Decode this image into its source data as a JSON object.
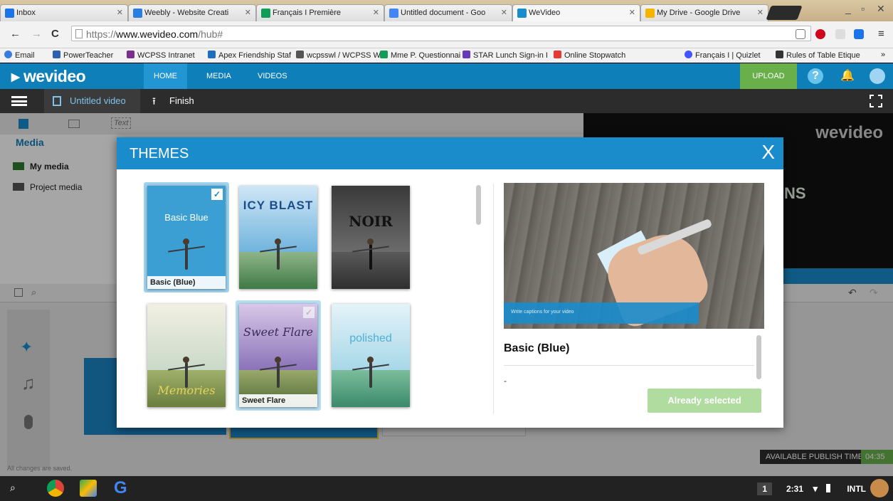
{
  "browser": {
    "tabs": [
      {
        "label": "Inbox",
        "icon": "inbox-icon",
        "color": "#1a73e8"
      },
      {
        "label": "Weebly - Website Creati",
        "icon": "weebly-icon",
        "color": "#2a7de1"
      },
      {
        "label": "Français I Première",
        "icon": "classroom-icon",
        "color": "#0f9d58"
      },
      {
        "label": "Untitled document - Goo",
        "icon": "docs-icon",
        "color": "#4285f4"
      },
      {
        "label": "WeVideo",
        "icon": "wevideo-icon",
        "color": "#1a8ccc"
      },
      {
        "label": "My Drive - Google Drive",
        "icon": "drive-icon",
        "color": "#f4b400"
      }
    ],
    "url_prefix": "https://",
    "url_host": "www.wevideo.com",
    "url_path": "/hub#",
    "bookmarks": [
      {
        "label": "Email",
        "color": "#3b7ddd"
      },
      {
        "label": "PowerTeacher",
        "color": "#2f5fae"
      },
      {
        "label": "WCPSS Intranet",
        "color": "#7a2e8e"
      },
      {
        "label": "Apex Friendship Staf",
        "color": "#1f6fbf"
      },
      {
        "label": "wcpsswl / WCPSS W",
        "color": "#555555"
      },
      {
        "label": "Mme P. Questionnai",
        "color": "#0f9d58"
      },
      {
        "label": "STAR Lunch Sign-in I",
        "color": "#673ab7"
      },
      {
        "label": "Online Stopwatch",
        "color": "#e53935"
      },
      {
        "label": "Français I | Quizlet",
        "color": "#4255ff"
      },
      {
        "label": "Rules of Table Etique",
        "color": "#333333"
      }
    ],
    "bookmarks_more": "»"
  },
  "app": {
    "logo": "wevideo",
    "nav": [
      "HOME",
      "MEDIA",
      "VIDEOS"
    ],
    "upload_label": "UPLOAD",
    "project_title": "Untitled video",
    "finish_label": "Finish",
    "media_tabs": {
      "text_tab": "Text"
    },
    "media_heading": "Media",
    "media_folders": [
      "My media",
      "Project media"
    ],
    "watermark": "wevideo",
    "preview_fragment": "NS",
    "status": "All changes are saved.",
    "publish_label": "AVAILABLE PUBLISH TIME",
    "publish_time": "04:35"
  },
  "themes_modal": {
    "title": "THEMES",
    "close": "X",
    "themes": [
      {
        "title": "Basic Blue",
        "label": "Basic (Blue)",
        "selected": true
      },
      {
        "title": "ICY BLAST",
        "label": "",
        "selected": false
      },
      {
        "title": "NOIR",
        "label": "",
        "selected": false
      },
      {
        "title": "Memories",
        "label": "",
        "selected": false
      },
      {
        "title": "Sweet Flare",
        "label": "Sweet Flare",
        "selected": false,
        "hovered": true
      },
      {
        "title": "polished",
        "label": "",
        "selected": false
      }
    ],
    "preview_caption": "Write captions for your video",
    "preview_title": "Basic (Blue)",
    "preview_desc": "-",
    "action_label": "Already selected"
  },
  "shelf": {
    "notification_count": "1",
    "time": "2:31",
    "input": "INTL"
  },
  "colors": {
    "brand_blue": "#1a8ccc",
    "upload_green": "#69b04a",
    "selected_green": "#b1dca0"
  }
}
